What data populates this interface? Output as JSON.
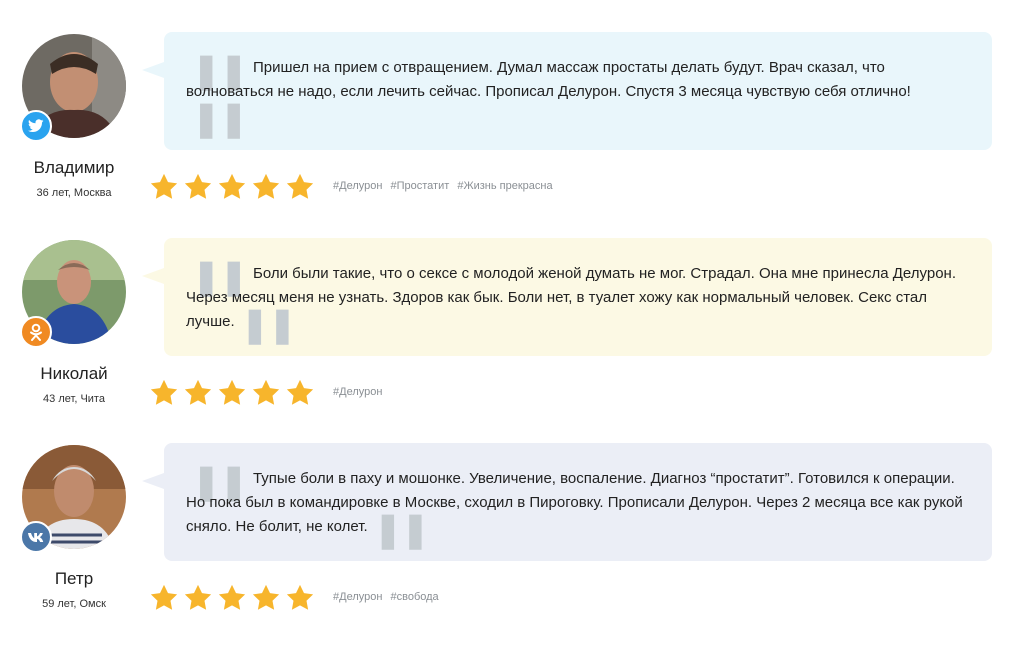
{
  "reviews": [
    {
      "name": "Владимир",
      "meta": "36 лет, Москва",
      "social": "twitter-icon",
      "bubble_color": "#e9f6fb",
      "text": "Пришел на прием с отвращением. Думал массаж простаты делать будут. Врач сказал, что волноваться не надо, если лечить сейчас. Прописал Делурон. Спустя 3 месяца чувствую себя отлично!",
      "rating": 5,
      "tags": [
        "#Делурон",
        "#Простатит",
        "#Жизнь прекрасна"
      ]
    },
    {
      "name": "Николай",
      "meta": "43 лет, Чита",
      "social": "odnoklassniki-icon",
      "bubble_color": "#fcf9e4",
      "text": "Боли были такие, что о сексе с молодой женой думать не мог. Страдал. Она мне принесла Делурон. Через месяц меня не узнать. Здоров как бык. Боли нет, в туалет хожу как нормальный человек. Секс стал лучше.",
      "rating": 5,
      "tags": [
        "#Делурон"
      ]
    },
    {
      "name": "Петр",
      "meta": "59 лет, Омск",
      "social": "vk-icon",
      "bubble_color": "#ebeef6",
      "text": "Тупые боли в паху и мошонке. Увеличение, воспаление. Диагноз “простатит”. Готовился к операции. Но пока был в командировке в Москве, сходил в Пироговку. Прописали Делурон. Через 2 месяца все как рукой сняло. Не болит, не колет.",
      "rating": 5,
      "tags": [
        "#Делурон",
        "#свобода"
      ]
    }
  ],
  "colors": {
    "star": "#f7b52c",
    "twitter": "#2aa3ef",
    "odnoklassniki": "#f08a22",
    "vk": "#4b77a8",
    "tag_text": "#8a8f94"
  }
}
